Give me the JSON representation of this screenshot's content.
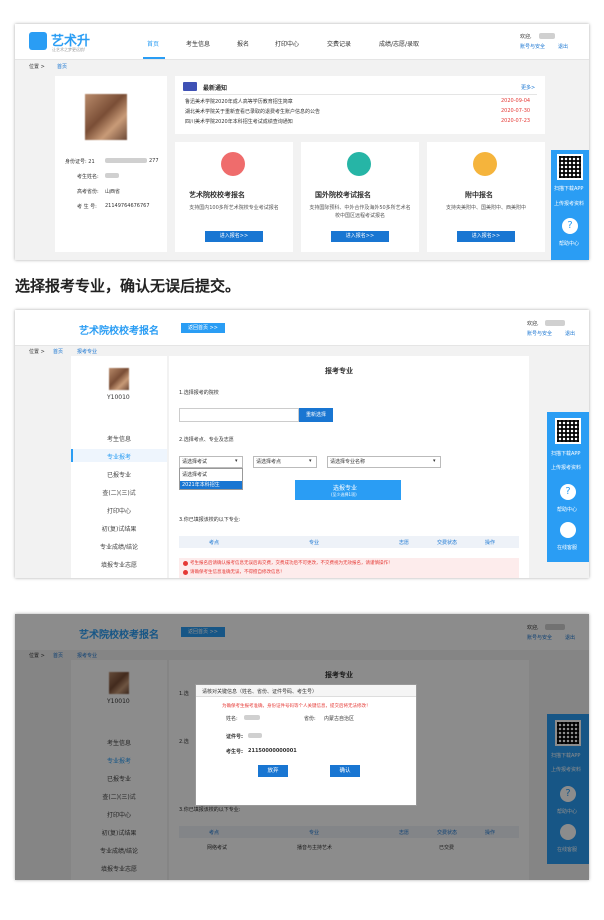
{
  "shot1": {
    "logo_text": "艺术升",
    "logo_sub": "让艺术之梦更远航!",
    "nav": [
      "首页",
      "考生信息",
      "报名",
      "打印中心",
      "交费记录",
      "成绩/志愿/录取"
    ],
    "welcome": "欢迎,",
    "account_link": "账号与安全",
    "logout_link": "退出",
    "breadcrumb_prefix": "位置 >",
    "breadcrumb_home": "首页",
    "profile": {
      "id_label": "身份证号: 21",
      "id_tail": "277",
      "name_label": "考生姓名:",
      "province_label": "高考省份:",
      "province_value": "山西省",
      "examno_label": "考 生 号:",
      "examno_value": "21149764676767"
    },
    "news": {
      "title": "最新通知",
      "more": "更多>",
      "items": [
        {
          "text": "鲁迅美术学院2020年成人高等学历教育招生简章",
          "date": "2020-09-04"
        },
        {
          "text": "湖北美术学院关于重新查看已录取的退费考生账户信息的公告",
          "date": "2020-07-30"
        },
        {
          "text": "四川美术学院2020年本科招生考试成绩查询通知",
          "date": "2020-07-23"
        }
      ]
    },
    "cards": [
      {
        "title": "艺术院校校考报名",
        "desc": "支持国内100多所艺术院校专业考试报名",
        "btn": "进入报名>>"
      },
      {
        "title": "国外院校考试报名",
        "desc": "支持国际预科、中外合作及海外50多所艺术名校中国区远程考试报名",
        "btn": "进入报名>>"
      },
      {
        "title": "附中报名",
        "desc": "支持央美附中、国美附中、西美附中",
        "btn": "进入报名>>"
      }
    ],
    "side": {
      "scan": "扫描下载APP",
      "upload": "上传报考资料",
      "help": "帮助中心"
    }
  },
  "caption": "选择报考专业，确认无误后提交。",
  "shot2": {
    "title": "艺术院校校考报名",
    "return_btn": "返回首页 >>",
    "welcome": "欢迎,",
    "account_link": "账号与安全",
    "logout_link": "退出",
    "breadcrumb_prefix": "位置 >",
    "breadcrumb_home": "首页",
    "breadcrumb_current": "报考专业",
    "user_id": "Y10010",
    "menu": [
      "考生信息",
      "专业报考",
      "已报专业",
      "查(二)(三)试",
      "打印中心",
      "初(复)试结果",
      "专业成绩/结论",
      "填报专业志愿"
    ],
    "form_title": "报考专业",
    "step1": "1.选择报考的院校",
    "switch_btn": "重新选择",
    "step2": "2.选择考点、专业及志愿",
    "select_exam": "请选择考试",
    "select_site": "请选择考点",
    "select_major": "请选择专业名称",
    "dropdown_options": [
      "请选择考试",
      "2021年本科招生"
    ],
    "pick_btn": "选报专业",
    "pick_btn_sub": "(至少选择1项)",
    "step3": "3.你已填报该校的以下专业:",
    "table_headers": [
      "考点",
      "专业",
      "志愿",
      "交费状态",
      "操作"
    ],
    "warn1": "考生报名后请确认报考信息无误后再交费，交费成功后不可更改，不交费视为无效报名，请谨慎操作！",
    "warn2": "请确保考生信息准确无误，不得擅自修改信息！",
    "side": {
      "scan": "扫描下载APP",
      "upload": "上传报考资料",
      "help": "帮助中心",
      "service": "在线客服"
    }
  },
  "shot3": {
    "title": "艺术院校校考报名",
    "return_btn": "返回首页 >>",
    "welcome": "欢迎,",
    "account_link": "账号与安全",
    "logout_link": "退出",
    "breadcrumb_prefix": "位置 >",
    "breadcrumb_home": "首页",
    "breadcrumb_current": "报考专业",
    "user_id": "Y10010",
    "form_title": "报考专业",
    "step1_short": "1.选",
    "step2_short": "2.选",
    "step3": "3.你已填报该校的以下专业:",
    "menu": [
      "考生信息",
      "专业报考",
      "已报专业",
      "查(二)(三)试",
      "打印中心",
      "初(复)试结果",
      "专业成绩/结论",
      "填报专业志愿"
    ],
    "table_headers": [
      "考点",
      "专业",
      "志愿",
      "交费状态",
      "操作"
    ],
    "table_row": {
      "site": "网络考试",
      "major": "播音与主持艺术",
      "status": "已交费"
    },
    "modal": {
      "header": "请核对关键信息（姓名、省份、证件号码、考生号）",
      "warn": "为确保考生报考准确，身份证件号码等个人关键信息，提交后将无法修改！",
      "name_label": "姓名:",
      "province_label": "省份:",
      "province_value": "内蒙古自治区",
      "id_label": "证件号:",
      "examno_label": "考生号:",
      "examno_value": "21150000000001",
      "cancel": "放弃",
      "confirm": "确认"
    },
    "side": {
      "scan": "扫描下载APP",
      "upload": "上传报考资料",
      "help": "帮助中心",
      "service": "在线客服"
    }
  },
  "colors": {
    "brand": "#2a9df4",
    "button": "#1976d2",
    "accent_red": "#e53935",
    "bg_gray": "#f2f2f2"
  }
}
